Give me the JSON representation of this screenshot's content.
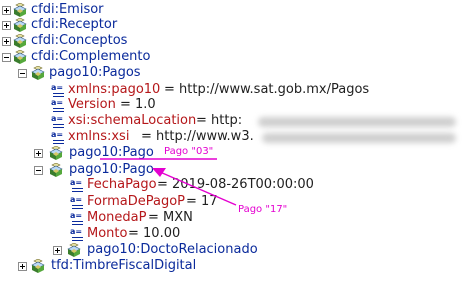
{
  "tree": {
    "emisor": "cfdi:Emisor",
    "receptor": "cfdi:Receptor",
    "conceptos": "cfdi:Conceptos",
    "complemento": "cfdi:Complemento",
    "pagos": "pago10:Pagos",
    "attr_xmlns": {
      "name": "xmlns:pago10",
      "value": " = http://www.sat.gob.mx/Pagos"
    },
    "attr_version": {
      "name": "Version",
      "value": " = 1.0"
    },
    "attr_schema": {
      "name": "xsi:schemaLocation",
      "value": " = http:"
    },
    "attr_xsi": {
      "name": "xmlns:xsi",
      "value": " = http://www.w3."
    },
    "pago1": "pago10:Pago",
    "pago2": "pago10:Pago",
    "fecha": {
      "name": "FechaPago",
      "value": " = 2019-08-26T00:00:00"
    },
    "forma": {
      "name": "FormaDePagoP",
      "value": " = 17"
    },
    "moneda": {
      "name": "MonedaP",
      "value": " = MXN"
    },
    "monto": {
      "name": "Monto",
      "value": " = 10.00"
    },
    "docto": "pago10:DoctoRelacionado",
    "timbre": "tfd:TimbreFiscalDigital"
  },
  "annotations": {
    "pago03": "Pago \"03\"",
    "pago17": "Pago \"17\""
  },
  "colors": {
    "annotation": "#e400d0",
    "element_text": "#0a2a9b",
    "attribute_name": "#b5171a"
  }
}
